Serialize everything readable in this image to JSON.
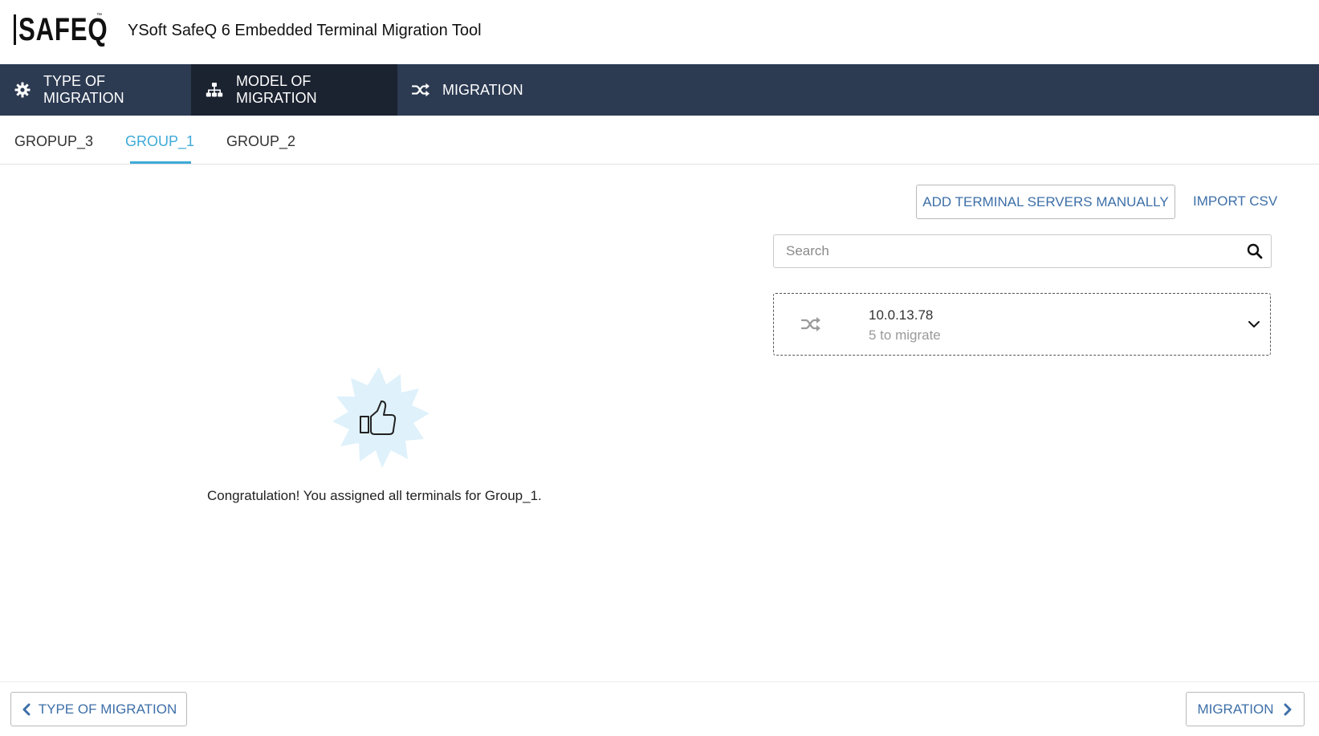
{
  "header": {
    "logo_text": "SAFEQ",
    "logo_tm": "™",
    "title": "YSoft SafeQ 6 Embedded Terminal Migration Tool"
  },
  "nav": {
    "items": [
      {
        "label": "TYPE OF MIGRATION",
        "icon": "gear-icon",
        "active": false
      },
      {
        "label": "MODEL OF MIGRATION",
        "icon": "sitemap-icon",
        "active": true
      },
      {
        "label": "MIGRATION",
        "icon": "shuffle-icon",
        "active": false
      }
    ]
  },
  "tabs": {
    "items": [
      {
        "label": "GROPUP_3",
        "active": false
      },
      {
        "label": "GROUP_1",
        "active": true
      },
      {
        "label": "GROUP_2",
        "active": false
      }
    ]
  },
  "actions": {
    "add_label": "ADD TERMINAL SERVERS MANUALLY",
    "import_label": "IMPORT CSV"
  },
  "search": {
    "placeholder": "Search",
    "value": ""
  },
  "servers": [
    {
      "ip": "10.0.13.78",
      "status": "5 to migrate",
      "icon": "shuffle-icon"
    }
  ],
  "empty_state": {
    "icon": "thumbs-up-icon",
    "message": "Congratulation! You assigned all terminals for Group_1."
  },
  "footer": {
    "back_label": "TYPE OF MIGRATION",
    "next_label": "MIGRATION"
  },
  "colors": {
    "nav_bg": "#2c3a52",
    "nav_active_bg": "#1b2230",
    "accent": "#3eaad8",
    "link": "#3d6fa8",
    "badge": "#dff1fb"
  }
}
